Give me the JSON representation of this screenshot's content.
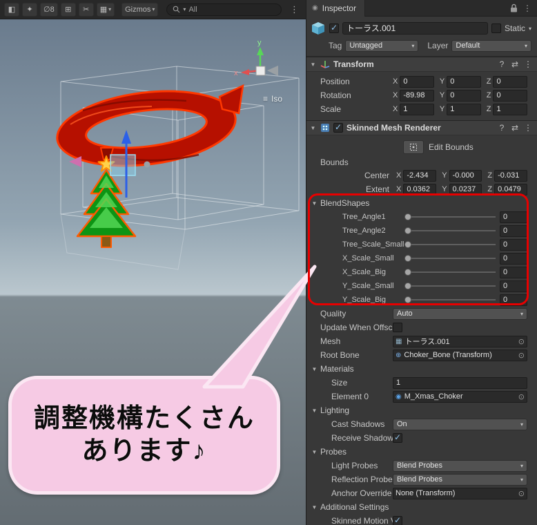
{
  "icons": {
    "kebab": "⋮",
    "caret": "▾",
    "fold": "▼",
    "check": "✓",
    "picker": "⊙",
    "help": "?",
    "presets": "⇄",
    "menu": "≡",
    "tab_dot": "◉",
    "mesh_glyph": "▦",
    "transform_glyph": "⊕",
    "material_glyph": "◉"
  },
  "toolbar": {
    "buttons": [
      {
        "name": "audio-toggle",
        "glyph": "◧"
      },
      {
        "name": "effects-toggle",
        "glyph": "✦"
      },
      {
        "name": "hidden-count",
        "glyph": "∅8"
      },
      {
        "name": "grid-toggle",
        "glyph": "⊞"
      },
      {
        "name": "cut-tool",
        "glyph": "✂"
      },
      {
        "name": "camera-view",
        "glyph": "▦"
      }
    ],
    "gizmos_label": "Gizmos",
    "search_value": "All"
  },
  "scene": {
    "iso_label": "Iso",
    "axis_x": "x",
    "axis_y": "y"
  },
  "bubble": {
    "line1": "調整機構たくさん",
    "line2": "あります♪"
  },
  "inspector": {
    "tab_title": "Inspector",
    "game_object": {
      "name": "トーラス.001",
      "static_label": "Static",
      "tag_label": "Tag",
      "tag_value": "Untagged",
      "layer_label": "Layer",
      "layer_value": "Default"
    },
    "axis": {
      "x": "X",
      "y": "Y",
      "z": "Z"
    },
    "transform": {
      "title": "Transform",
      "rows": [
        {
          "label": "Position",
          "x": "0",
          "y": "0",
          "z": "0"
        },
        {
          "label": "Rotation",
          "x": "-89.98",
          "y": "0",
          "z": "0"
        },
        {
          "label": "Scale",
          "x": "1",
          "y": "1",
          "z": "1"
        }
      ]
    },
    "smr": {
      "title": "Skinned Mesh Renderer",
      "edit_bounds": "Edit Bounds",
      "bounds_label": "Bounds",
      "bounds_rows": [
        {
          "label": "Center",
          "x": "-2.434",
          "y": "-0.000",
          "z": "-0.031"
        },
        {
          "label": "Extent",
          "x": "0.0362",
          "y": "0.0237",
          "z": "0.0479"
        }
      ],
      "blendshapes_title": "BlendShapes",
      "blendshapes": [
        {
          "label": "Tree_Angle1",
          "value": "0"
        },
        {
          "label": "Tree_Angle2",
          "value": "0"
        },
        {
          "label": "Tree_Scale_Small",
          "value": "0"
        },
        {
          "label": "X_Scale_Small",
          "value": "0"
        },
        {
          "label": "X_Scale_Big",
          "value": "0"
        },
        {
          "label": "Y_Scale_Small",
          "value": "0"
        },
        {
          "label": "Y_Scale_Big",
          "value": "0"
        }
      ],
      "quality_label": "Quality",
      "quality_value": "Auto",
      "update_offscreen_label": "Update When Offscre",
      "mesh_label": "Mesh",
      "mesh_value": "トーラス.001",
      "root_bone_label": "Root Bone",
      "root_bone_value": "Choker_Bone (Transform)",
      "materials_title": "Materials",
      "size_label": "Size",
      "size_value": "1",
      "element0_label": "Element 0",
      "element0_value": "M_Xmas_Choker",
      "lighting_title": "Lighting",
      "cast_shadows_label": "Cast Shadows",
      "cast_shadows_value": "On",
      "receive_shadows_label": "Receive Shadows",
      "probes_title": "Probes",
      "light_probes_label": "Light Probes",
      "light_probes_value": "Blend Probes",
      "reflection_probes_label": "Reflection Probes",
      "reflection_probes_value": "Blend Probes",
      "anchor_label": "Anchor Override",
      "anchor_value": "None (Transform)",
      "additional_title": "Additional Settings",
      "skinned_motion_label": "Skinned Motion Ve"
    }
  }
}
